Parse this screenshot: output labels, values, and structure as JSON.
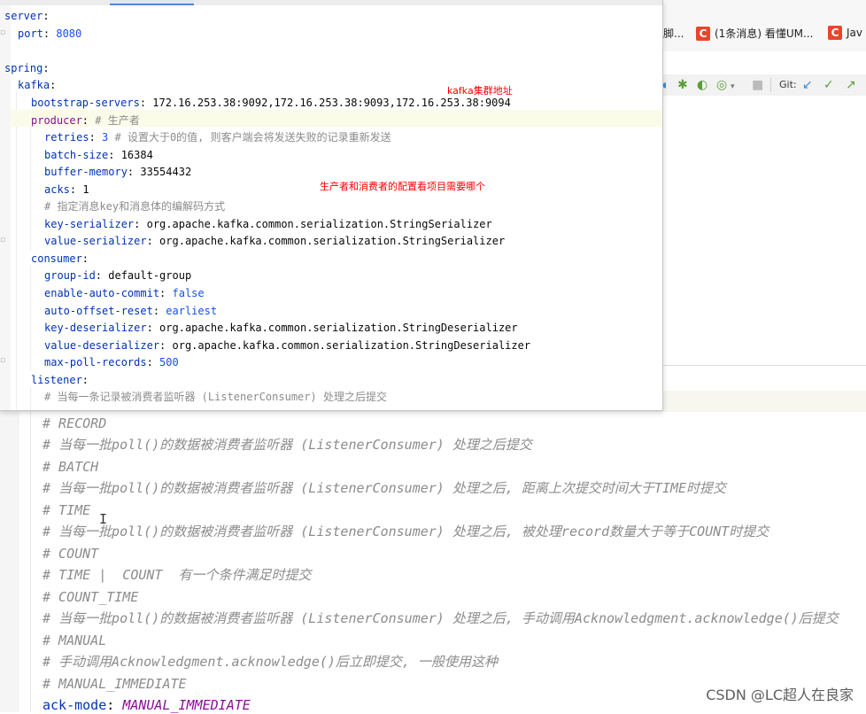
{
  "browser": {
    "bookmarks": [
      {
        "icon": "C",
        "label": "脚..."
      },
      {
        "icon": "C",
        "label": "(1条消息) 看懂UM..."
      },
      {
        "icon": "C",
        "label": "Jav"
      }
    ]
  },
  "ide_toolbar": {
    "git_label": "Git:"
  },
  "annotations": {
    "cluster_address": "kafka集群地址",
    "producer_consumer_note": "生产者和消费者的配置看项目需要哪个"
  },
  "top_editor": {
    "lines": [
      {
        "indent": 0,
        "key": "server",
        "sep": ":",
        "value": "",
        "comment": ""
      },
      {
        "indent": 1,
        "key": "port",
        "sep": ": ",
        "value": "8080",
        "value_type": "number",
        "comment": ""
      },
      {
        "indent": 0,
        "key": "",
        "sep": "",
        "value": "",
        "comment": ""
      },
      {
        "indent": 0,
        "key": "spring",
        "sep": ":",
        "value": "",
        "comment": ""
      },
      {
        "indent": 1,
        "key": "kafka",
        "sep": ":",
        "value": "",
        "comment": ""
      },
      {
        "indent": 2,
        "key": "bootstrap-servers",
        "sep": ": ",
        "value": "172.16.253.38:9092,172.16.253.38:9093,172.16.253.38:9094",
        "value_type": "text",
        "comment": ""
      },
      {
        "indent": 2,
        "key": "producer",
        "sep": ": ",
        "value": "",
        "comment": "# 生产者",
        "key_style": "purple"
      },
      {
        "indent": 3,
        "key": "retries",
        "sep": ": ",
        "value": "3",
        "value_type": "number",
        "comment": " # 设置大于0的值, 则客户端会将发送失败的记录重新发送"
      },
      {
        "indent": 3,
        "key": "batch-size",
        "sep": ": ",
        "value": "16384",
        "value_type": "text",
        "comment": ""
      },
      {
        "indent": 3,
        "key": "buffer-memory",
        "sep": ": ",
        "value": "33554432",
        "value_type": "text",
        "comment": ""
      },
      {
        "indent": 3,
        "key": "acks",
        "sep": ": ",
        "value": "1",
        "value_type": "text",
        "comment": ""
      },
      {
        "indent": 3,
        "key": "",
        "sep": "",
        "value": "",
        "comment": "# 指定消息key和消息体的编解码方式"
      },
      {
        "indent": 3,
        "key": "key-serializer",
        "sep": ": ",
        "value": "org.apache.kafka.common.serialization.StringSerializer",
        "value_type": "text",
        "comment": ""
      },
      {
        "indent": 3,
        "key": "value-serializer",
        "sep": ": ",
        "value": "org.apache.kafka.common.serialization.StringSerializer",
        "value_type": "text",
        "comment": ""
      },
      {
        "indent": 2,
        "key": "consumer",
        "sep": ":",
        "value": "",
        "comment": ""
      },
      {
        "indent": 3,
        "key": "group-id",
        "sep": ": ",
        "value": "default-group",
        "value_type": "text",
        "comment": ""
      },
      {
        "indent": 3,
        "key": "enable-auto-commit",
        "sep": ": ",
        "value": "false",
        "value_type": "keyword",
        "comment": ""
      },
      {
        "indent": 3,
        "key": "auto-offset-reset",
        "sep": ": ",
        "value": "earliest",
        "value_type": "keyword",
        "comment": ""
      },
      {
        "indent": 3,
        "key": "key-deserializer",
        "sep": ": ",
        "value": "org.apache.kafka.common.serialization.StringDeserializer",
        "value_type": "text",
        "comment": ""
      },
      {
        "indent": 3,
        "key": "value-deserializer",
        "sep": ": ",
        "value": "org.apache.kafka.common.serialization.StringDeserializer",
        "value_type": "text",
        "comment": ""
      },
      {
        "indent": 3,
        "key": "max-poll-records",
        "sep": ": ",
        "value": "500",
        "value_type": "number",
        "comment": ""
      },
      {
        "indent": 2,
        "key": "listener",
        "sep": ":",
        "value": "",
        "comment": ""
      },
      {
        "indent": 3,
        "key": "",
        "sep": "",
        "value": "",
        "comment": "# 当每一条记录被消费者监听器 (ListenerConsumer) 处理之后提交"
      }
    ]
  },
  "bottom_editor": {
    "lines": [
      "# RECORD",
      "# 当每一批poll()的数据被消费者监听器 (ListenerConsumer) 处理之后提交",
      "# BATCH",
      "# 当每一批poll()的数据被消费者监听器 (ListenerConsumer) 处理之后, 距离上次提交时间大于TIME时提交",
      "# TIME",
      "# 当每一批poll()的数据被消费者监听器 (ListenerConsumer) 处理之后, 被处理record数量大于等于COUNT时提交",
      "# COUNT",
      "# TIME |  COUNT  有一个条件满足时提交",
      "# COUNT_TIME",
      "# 当每一批poll()的数据被消费者监听器 (ListenerConsumer) 处理之后, 手动调用Acknowledgment.acknowledge()后提交",
      "# MANUAL",
      "# 手动调用Acknowledgment.acknowledge()后立即提交, 一般使用这种",
      "# MANUAL_IMMEDIATE"
    ],
    "ack_mode": {
      "key": "ack-mode",
      "sep": ": ",
      "value": "MANUAL_IMMEDIATE"
    }
  },
  "watermark": "CSDN @LC超人在良家",
  "colors": {
    "yaml_key": "#0033b3",
    "yaml_value_keyword": "#871094",
    "comment": "#8c8c8c",
    "number": "#1750eb",
    "annotation_red": "#ff0000"
  }
}
